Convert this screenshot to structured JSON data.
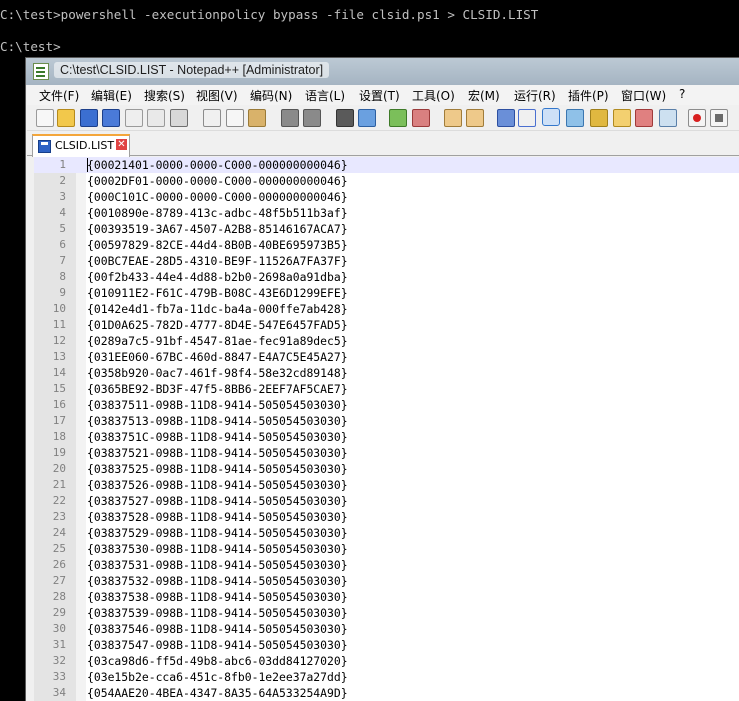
{
  "console": {
    "lines": [
      "C:\\test>powershell -executionpolicy bypass -file clsid.ps1 > CLSID.LIST",
      "",
      "C:\\test>"
    ]
  },
  "window": {
    "title": "C:\\test\\CLSID.LIST - Notepad++ [Administrator]"
  },
  "menu": [
    "文件(F)",
    "编辑(E)",
    "搜索(S)",
    "视图(V)",
    "编码(N)",
    "语言(L)",
    "设置(T)",
    "工具(O)",
    "宏(M)",
    "运行(R)",
    "插件(P)",
    "窗口(W)",
    "?"
  ],
  "toolbar": {
    "icons": [
      "new-icon",
      "open-icon",
      "save-icon",
      "save-all-icon",
      "close-icon",
      "close-all-icon",
      "print-icon",
      "cut-icon",
      "copy-icon",
      "paste-icon",
      "undo-icon",
      "redo-icon",
      "find-icon",
      "replace-icon",
      "zoom-in-icon",
      "zoom-out-icon",
      "sync-vertical-icon",
      "sync-horizontal-icon",
      "word-wrap-icon",
      "show-all-chars-icon",
      "indent-guide-icon",
      "doc-map-icon",
      "function-list-icon",
      "folder-workspace-icon",
      "monitoring-icon",
      "macro-record-icon",
      "macro-stop-icon"
    ],
    "colors": {
      "accent": "#3377cc",
      "record": "#d82020"
    }
  },
  "tab": {
    "label": "CLSID.LIST"
  },
  "editor": {
    "lines": [
      {
        "num": "1",
        "text": "{00021401-0000-0000-C000-000000000046}"
      },
      {
        "num": "2",
        "text": "{0002DF01-0000-0000-C000-000000000046}"
      },
      {
        "num": "3",
        "text": "{000C101C-0000-0000-C000-000000000046}"
      },
      {
        "num": "4",
        "text": "{0010890e-8789-413c-adbc-48f5b511b3af}"
      },
      {
        "num": "5",
        "text": "{00393519-3A67-4507-A2B8-85146167ACA7}"
      },
      {
        "num": "6",
        "text": "{00597829-82CE-44d4-8B0B-40BE695973B5}"
      },
      {
        "num": "7",
        "text": "{00BC7EAE-28D5-4310-BE9F-11526A7FA37F}"
      },
      {
        "num": "8",
        "text": "{00f2b433-44e4-4d88-b2b0-2698a0a91dba}"
      },
      {
        "num": "9",
        "text": "{010911E2-F61C-479B-B08C-43E6D1299EFE}"
      },
      {
        "num": "10",
        "text": "{0142e4d1-fb7a-11dc-ba4a-000ffe7ab428}"
      },
      {
        "num": "11",
        "text": "{01D0A625-782D-4777-8D4E-547E6457FAD5}"
      },
      {
        "num": "12",
        "text": "{0289a7c5-91bf-4547-81ae-fec91a89dec5}"
      },
      {
        "num": "13",
        "text": "{031EE060-67BC-460d-8847-E4A7C5E45A27}"
      },
      {
        "num": "14",
        "text": "{0358b920-0ac7-461f-98f4-58e32cd89148}"
      },
      {
        "num": "15",
        "text": "{0365BE92-BD3F-47f5-8BB6-2EEF7AF5CAE7}"
      },
      {
        "num": "16",
        "text": "{03837511-098B-11D8-9414-505054503030}"
      },
      {
        "num": "17",
        "text": "{03837513-098B-11D8-9414-505054503030}"
      },
      {
        "num": "18",
        "text": "{0383751C-098B-11D8-9414-505054503030}"
      },
      {
        "num": "19",
        "text": "{03837521-098B-11D8-9414-505054503030}"
      },
      {
        "num": "20",
        "text": "{03837525-098B-11D8-9414-505054503030}"
      },
      {
        "num": "21",
        "text": "{03837526-098B-11D8-9414-505054503030}"
      },
      {
        "num": "22",
        "text": "{03837527-098B-11D8-9414-505054503030}"
      },
      {
        "num": "23",
        "text": "{03837528-098B-11D8-9414-505054503030}"
      },
      {
        "num": "24",
        "text": "{03837529-098B-11D8-9414-505054503030}"
      },
      {
        "num": "25",
        "text": "{03837530-098B-11D8-9414-505054503030}"
      },
      {
        "num": "26",
        "text": "{03837531-098B-11D8-9414-505054503030}"
      },
      {
        "num": "27",
        "text": "{03837532-098B-11D8-9414-505054503030}"
      },
      {
        "num": "28",
        "text": "{03837538-098B-11D8-9414-505054503030}"
      },
      {
        "num": "29",
        "text": "{03837539-098B-11D8-9414-505054503030}"
      },
      {
        "num": "30",
        "text": "{03837546-098B-11D8-9414-505054503030}"
      },
      {
        "num": "31",
        "text": "{03837547-098B-11D8-9414-505054503030}"
      },
      {
        "num": "32",
        "text": "{03ca98d6-ff5d-49b8-abc6-03dd84127020}"
      },
      {
        "num": "33",
        "text": "{03e15b2e-cca6-451c-8fb0-1e2ee37a27dd}"
      },
      {
        "num": "34",
        "text": "{054AAE20-4BEA-4347-8A35-64A533254A9D}"
      }
    ]
  }
}
